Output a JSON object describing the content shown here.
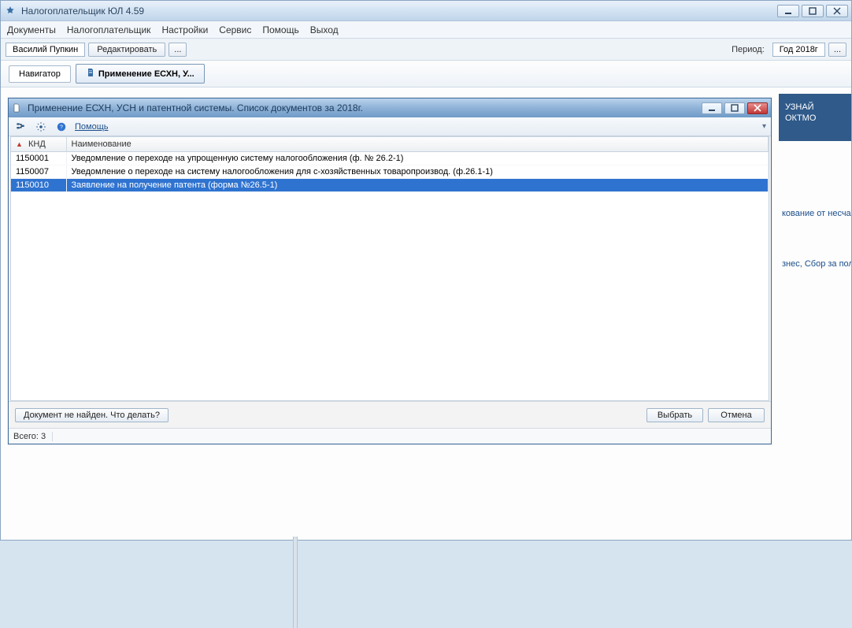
{
  "app": {
    "title": "Налогоплательщик ЮЛ 4.59"
  },
  "menu": {
    "documents": "Документы",
    "taxpayer": "Налогоплательщик",
    "settings": "Настройки",
    "service": "Сервис",
    "help": "Помощь",
    "exit": "Выход"
  },
  "toolbar": {
    "user": "Василий Пупкин",
    "edit": "Редактировать",
    "ellipsis": "...",
    "period_label": "Период:",
    "year": "Год 2018г",
    "ellipsis2": "..."
  },
  "tabs": {
    "navigator": "Навигатор",
    "active": "Применение ЕСХН, У..."
  },
  "side": {
    "card1_line1": "УЗНАЙ",
    "card1_line2": "ОКТМО",
    "link1": "кование от несчаст",
    "link2": "знес, Сбор за польз"
  },
  "dialog": {
    "title": "Применение ЕСХН, УСН и патентной системы. Список документов за 2018г.",
    "help": "Помощь",
    "columns": {
      "knd": "КНД",
      "name": "Наименование"
    },
    "rows": [
      {
        "knd": "1150001",
        "name": "Уведомление о переходе на упрощенную систему налогообложения (ф. № 26.2-1)",
        "selected": false
      },
      {
        "knd": "1150007",
        "name": "Уведомление  о переходе на систему налогообложения  для с-хозяйственных товаропроизвод. (ф.26.1-1)",
        "selected": false
      },
      {
        "knd": "1150010",
        "name": "Заявление на получение патента (форма №26.5-1)",
        "selected": true
      }
    ],
    "not_found": "Документ не найден. Что делать?",
    "select": "Выбрать",
    "cancel": "Отмена",
    "status_total": "Всего: 3"
  }
}
